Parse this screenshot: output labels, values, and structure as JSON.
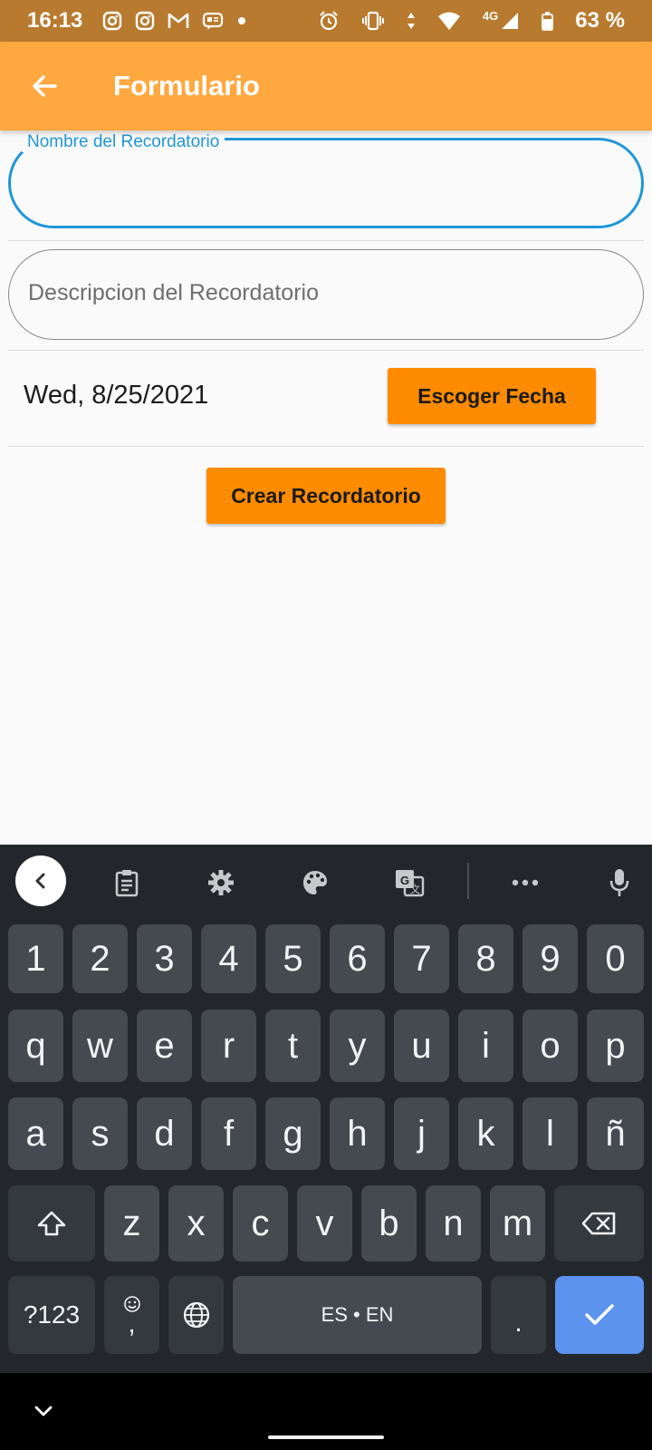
{
  "status_bar": {
    "time": "16:13",
    "network": "4G",
    "battery": "63 %",
    "icons": [
      "instagram-icon",
      "instagram-icon",
      "gmail-icon",
      "message-icon",
      "dot-icon",
      "alarm-icon",
      "vibrate-icon",
      "data-arrows-icon",
      "wifi-icon",
      "signal-icon",
      "battery-icon"
    ]
  },
  "app_bar": {
    "title": "Formulario",
    "back_icon": "arrow-left-icon",
    "color": "#ffa840"
  },
  "form": {
    "name_field": {
      "label": "Nombre del Recordatorio",
      "value": ""
    },
    "description_field": {
      "placeholder": "Descripcion del Recordatorio",
      "value": ""
    },
    "date_text": "Wed, 8/25/2021",
    "choose_date_button": "Escoger Fecha",
    "create_button": "Crear Recordatorio",
    "accent_color": "#ff8c00",
    "focus_color": "#2196d8"
  },
  "keyboard": {
    "toolbar_icons": [
      "chevron-left-icon",
      "clipboard-icon",
      "gear-icon",
      "palette-icon",
      "translate-icon",
      "more-dots-icon",
      "microphone-icon"
    ],
    "row_numbers": [
      "1",
      "2",
      "3",
      "4",
      "5",
      "6",
      "7",
      "8",
      "9",
      "0"
    ],
    "row1": [
      "q",
      "w",
      "e",
      "r",
      "t",
      "y",
      "u",
      "i",
      "o",
      "p"
    ],
    "row2": [
      "a",
      "s",
      "d",
      "f",
      "g",
      "h",
      "j",
      "k",
      "l",
      "ñ"
    ],
    "row3": [
      "z",
      "x",
      "c",
      "v",
      "b",
      "n",
      "m"
    ],
    "symbols_key": "?123",
    "comma_key": ",",
    "space_key": "ES • EN",
    "period_key": ".",
    "enter_color": "#5b93ee"
  }
}
